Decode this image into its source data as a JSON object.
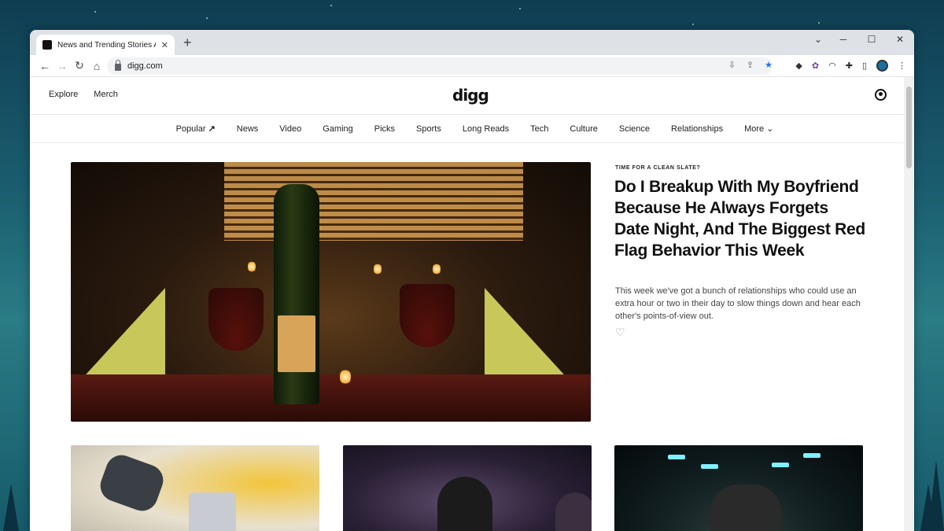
{
  "browser": {
    "tab_title": "News and Trending Stories Around",
    "tab_close": "✕",
    "new_tab": "+",
    "url": "digg.com",
    "controls": {
      "minimize": "⌄",
      "restore": "─",
      "maximize": "☐",
      "close": "✕"
    }
  },
  "site": {
    "header_links": [
      "Explore",
      "Merch"
    ],
    "logo": "digg",
    "categories": [
      "Popular",
      "News",
      "Video",
      "Gaming",
      "Picks",
      "Sports",
      "Long Reads",
      "Tech",
      "Culture",
      "Science",
      "Relationships",
      "More"
    ],
    "popular_icon": "trending-up-icon",
    "more_icon": "chevron-down-icon"
  },
  "hero": {
    "kicker": "TIME FOR A CLEAN SLATE?",
    "title": "Do I Breakup With My Boyfriend Because He Always Forgets Date Night, And The Biggest Red Flag Behavior This Week",
    "description": "This week we've got a bunch of relationships who could use an extra hour or two in their day to slow things down and hear each other's points-of-view out.",
    "like_icon": "heart-icon"
  },
  "colors": {
    "chrome_bg": "#dee1e6",
    "text": "#111111",
    "accent_star": "#1a73e8"
  }
}
